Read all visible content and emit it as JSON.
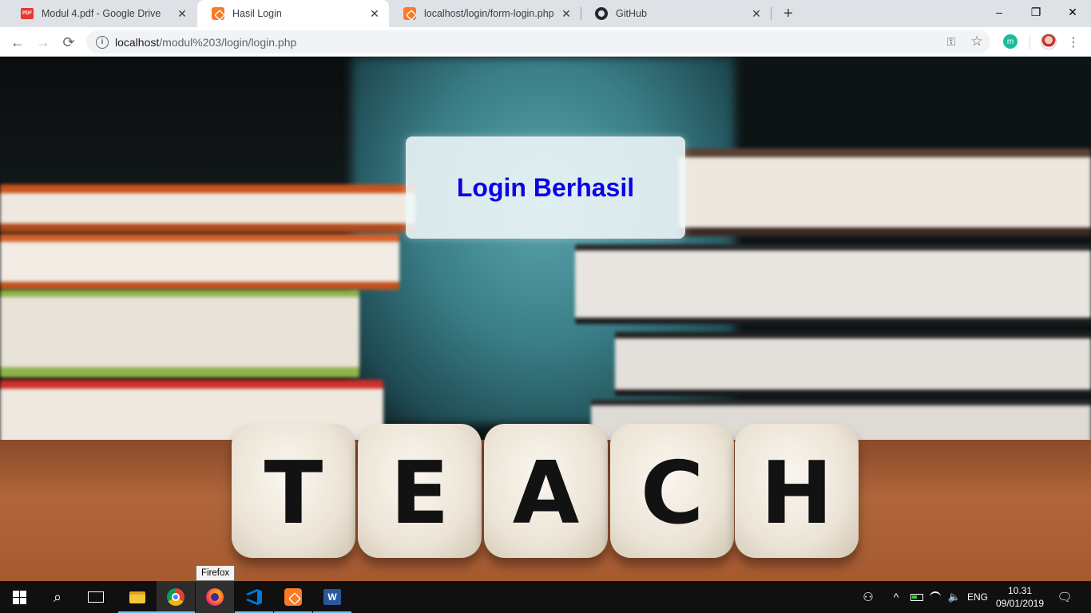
{
  "browser": {
    "tabs": [
      {
        "label": "Modul 4.pdf - Google Drive",
        "icon": "pdf-icon",
        "active": false
      },
      {
        "label": "Hasil Login",
        "icon": "xampp-icon",
        "active": true
      },
      {
        "label": "localhost/login/form-login.php",
        "icon": "xampp-icon",
        "active": false
      },
      {
        "label": "GitHub",
        "icon": "github-icon",
        "active": false
      }
    ],
    "new_tab": "+",
    "window_controls": {
      "minimize": "–",
      "restore": "❐",
      "close": "✕"
    },
    "nav": {
      "back": "←",
      "forward": "→",
      "reload": "⟳"
    },
    "address": {
      "info": "i",
      "host": "localhost",
      "path": "/modul%203/login/login.php"
    },
    "toolbar_icons": {
      "key": "⚿",
      "star": "☆",
      "extension": "m",
      "menu": "⋮"
    }
  },
  "page": {
    "message": "Login Berhasil",
    "background_letters": [
      "T",
      "E",
      "A",
      "C",
      "H"
    ],
    "accent_color": "#0d00e6"
  },
  "tooltip": "Firefox",
  "taskbar": {
    "apps": [
      "start-icon",
      "search-icon",
      "task-view-icon",
      "file-explorer-icon",
      "chrome-icon",
      "firefox-icon",
      "vscode-icon",
      "xampp-icon",
      "word-icon"
    ],
    "word_letter": "W",
    "tray": {
      "people": "⚇",
      "chevron": "^",
      "language": "ENG",
      "volume": "🔈"
    },
    "time": "10.31",
    "date": "09/01/2019",
    "notification": "🗨"
  }
}
